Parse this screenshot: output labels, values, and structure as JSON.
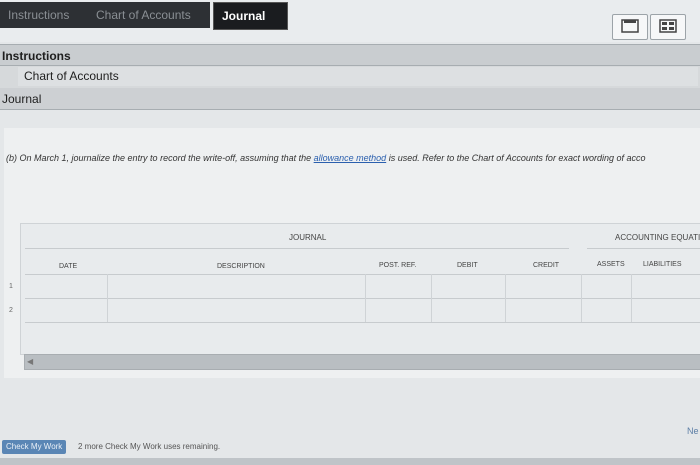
{
  "tabs": [
    {
      "label": "Instructions"
    },
    {
      "label": "Chart of Accounts"
    },
    {
      "label": "Journal"
    }
  ],
  "nav": {
    "instructions": "Instructions",
    "chart_of_accounts": "Chart of Accounts",
    "journal": "Journal"
  },
  "question": {
    "prefix": "(b) On March 1, journalize the entry to record the write-off, assuming that the ",
    "link": "allowance method",
    "suffix": " is used. Refer to the Chart of Accounts for exact wording of acco"
  },
  "table": {
    "journal_title": "JOURNAL",
    "equation_title": "ACCOUNTING EQUATI",
    "columns": {
      "date": "DATE",
      "description": "DESCRIPTION",
      "post_ref": "POST. REF.",
      "debit": "DEBIT",
      "credit": "CREDIT",
      "assets": "ASSETS",
      "liabilities": "LIABILITIES"
    },
    "rows": [
      "1",
      "2"
    ]
  },
  "footer": {
    "next": "Ne",
    "check_button": "Check My Work",
    "remaining": "2 more Check My Work uses remaining."
  }
}
